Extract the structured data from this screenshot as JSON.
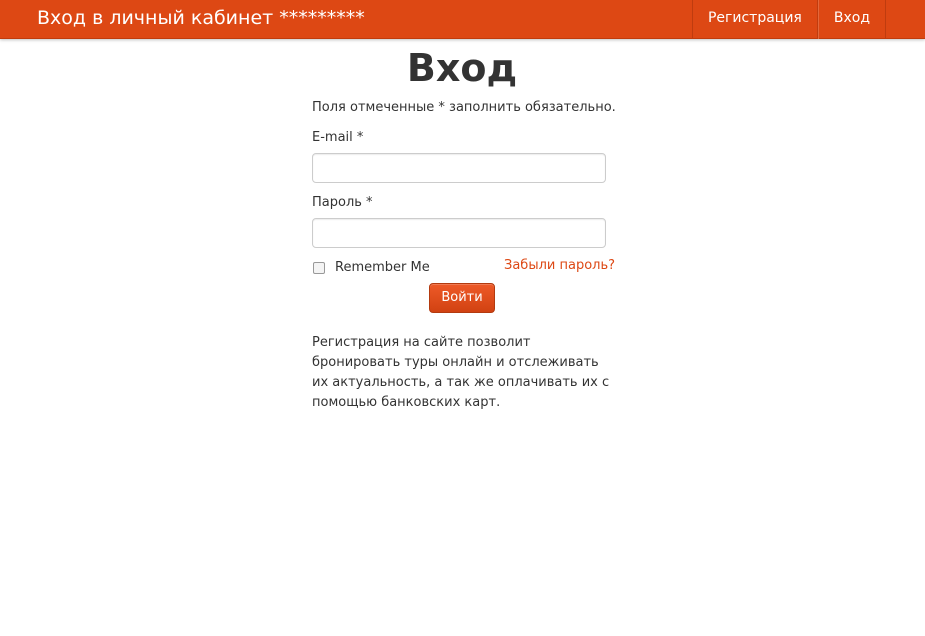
{
  "navbar": {
    "brand": "Вход в личный кабинет *********",
    "links": [
      {
        "label": "Регистрация"
      },
      {
        "label": "Вход"
      }
    ]
  },
  "form": {
    "title": "Вход",
    "required_hint": "Поля отмеченные * заполнить обязательно.",
    "email_label": "E-mail *",
    "email_value": "",
    "password_label": "Пароль *",
    "password_value": "",
    "remember_label": "Remember Me",
    "remember_checked": false,
    "forgot_link": "Забыли пароль?",
    "submit_label": "Войти"
  },
  "info_text": "Регистрация на сайте позволит бронировать туры онлайн и отслеживать их актуальность, а так же оплачивать их с помощью банковских карт.",
  "colors": {
    "accent": "#dd4814",
    "text": "#333333"
  }
}
